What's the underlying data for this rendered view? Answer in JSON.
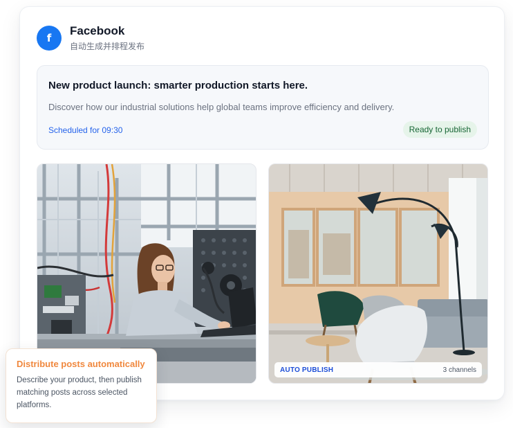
{
  "platform": {
    "icon": "facebook-icon",
    "icon_letter": "f",
    "name": "Facebook",
    "subtitle": "自动生成并排程发布",
    "brand_color": "#1877f2"
  },
  "post": {
    "title": "New product launch: smarter production starts here.",
    "description": "Discover how our industrial solutions help global teams improve efficiency and delivery.",
    "schedule": "Scheduled for 09:30",
    "status": "Ready to publish"
  },
  "media": {
    "auto_label": "AUTO PUBLISH",
    "channels": "3 channels"
  },
  "tooltip": {
    "title": "Distribute posts automatically",
    "body": "Describe your product, then publish matching posts across selected platforms."
  }
}
